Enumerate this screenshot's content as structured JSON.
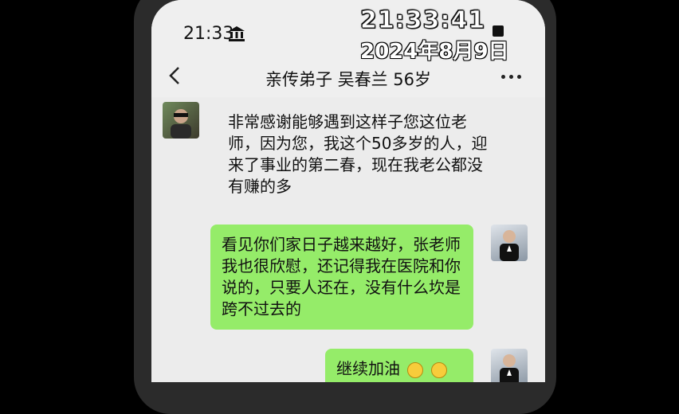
{
  "status_bar": {
    "time": "21:33"
  },
  "overlay": {
    "time": "21:33:41",
    "date": "2024年8月9日"
  },
  "header": {
    "title": "亲传弟子 吴春兰 56岁"
  },
  "messages": [
    {
      "direction": "incoming",
      "text": "非常感谢能够遇到这样子您这位老师，因为您，我这个50多岁的人，迎来了事业的第二春，现在我老公都没有赚的多"
    },
    {
      "direction": "outgoing",
      "text": "看见你们家日子越来越好，张老师我也很欣慰，还记得我在医院和你说的，只要人还在，没有什么坎是跨不过去的"
    },
    {
      "direction": "outgoing",
      "text": "继续加油"
    }
  ],
  "colors": {
    "outgoing_bubble": "#95ec69",
    "background": "#ececec"
  }
}
